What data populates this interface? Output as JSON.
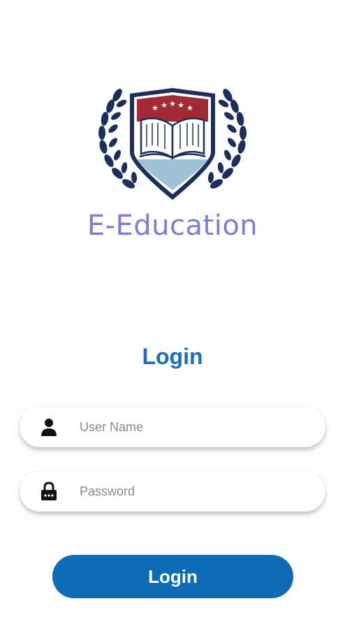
{
  "brand": {
    "name": "E-Education",
    "logo": "school-crest-logo"
  },
  "login": {
    "title": "Login",
    "username": {
      "placeholder": "User Name",
      "value": "",
      "icon": "user-icon"
    },
    "password": {
      "placeholder": "Password",
      "value": "",
      "icon": "lock-icon"
    },
    "button_label": "Login"
  },
  "colors": {
    "accent": "#0c6cb8",
    "brand_text": "#7b7fd4",
    "crest_navy": "#1b2f5a",
    "crest_red": "#a32a35",
    "crest_blue": "#9ec3d6"
  }
}
